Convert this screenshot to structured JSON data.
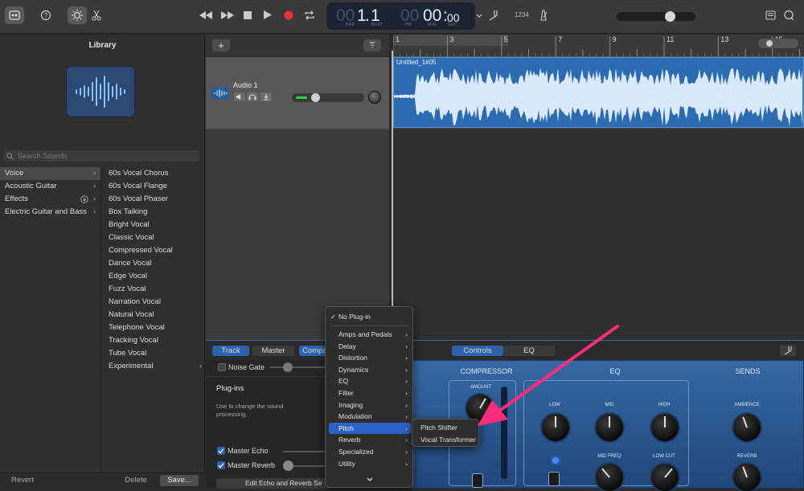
{
  "toolbar": {
    "lcd": {
      "bar": "1",
      "beat": "1",
      "hr": "00",
      "min": "00",
      "sec": "00",
      "bar_label": "BAR",
      "beat_label": "BEAT",
      "hr_label": "HR",
      "min_label": "MIN",
      "sec_label": "SEC",
      "bar_dim": "00",
      "hr_dim": "00"
    },
    "signature": "1234"
  },
  "library": {
    "title": "Library",
    "search_placeholder": "Search Sounds",
    "categories": [
      "Voice",
      "Acoustic Guitar",
      "Effects",
      "Electric Guitar and Bass"
    ],
    "presets": [
      "60s Vocal Chorus",
      "60s Vocal Flange",
      "60s Vocal Phaser",
      "Box Talking",
      "Bright Vocal",
      "Classic Vocal",
      "Compressed Vocal",
      "Dance Vocal",
      "Edge Vocal",
      "Fuzz Vocal",
      "Narration Vocal",
      "Natural Vocal",
      "Telephone Vocal",
      "Tracking Vocal",
      "Tube Vocal",
      "Experimental"
    ],
    "footer": {
      "revert": "Revert",
      "delete": "Delete",
      "save": "Save..."
    }
  },
  "ruler": {
    "marks": [
      "1",
      "3",
      "5",
      "7",
      "9",
      "11",
      "13",
      "15"
    ]
  },
  "track": {
    "name": "Audio 1",
    "region_name": "Untitled_1#05"
  },
  "editor": {
    "tabs": {
      "track": "Track",
      "master": "Master",
      "compare": "Compa",
      "controls": "Controls",
      "eq": "EQ"
    },
    "noise_gate": "Noise Gate",
    "plugins_title": "Plug-ins",
    "plugins_desc": "Use to change the sound processing.",
    "master_echo": "Master Echo",
    "master_reverb": "Master Reverb",
    "edit_button": "Edit Echo and Reverb Se",
    "panel": {
      "compressor": "COMPRESSOR",
      "eq": "EQ",
      "sends": "SENDS",
      "amount": "AMOUNT",
      "low": "LOW",
      "mid": "MID",
      "high": "HIGH",
      "mid_freq": "MID FREQ",
      "low_cut": "LOW CUT",
      "ambience": "AMBIENCE",
      "reverb": "REVERB"
    }
  },
  "menu": {
    "no_plugin": "No Plug-in",
    "items": [
      "Amps and Pedals",
      "Delay",
      "Distortion",
      "Dynamics",
      "EQ",
      "Filter",
      "Imaging",
      "Modulation",
      "Pitch",
      "Reverb",
      "Specialized",
      "Utility"
    ],
    "highlighted": "Pitch",
    "submenu": [
      "Pitch Shifter",
      "Vocal Transformer"
    ]
  },
  "colors": {
    "accent": "#2c62c8",
    "region": "#2d6bb0",
    "arrow": "#ff2d7a",
    "panel": "#2f5e96"
  }
}
